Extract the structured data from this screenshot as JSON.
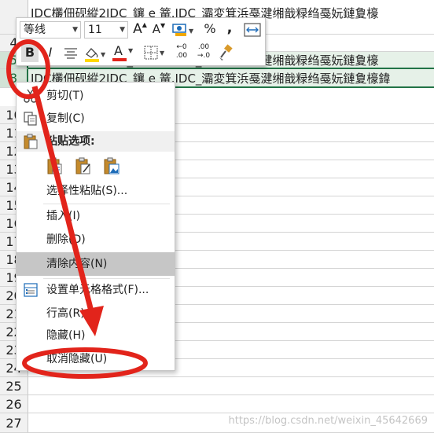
{
  "sheet": {
    "top_text": "IDC欉佃砚縱2IDC_鑲 e 篭.IDC_灞変箕浜戞湕缃戠粶绉戞妧鏈夐檺",
    "row5_text": "IDC欉佃砚縱2IDC_鑲 e 篭.IDC_灞変箕浜戞湕缃戠粶绉戞妧鏈夐檺",
    "row8_text": "IDC欉佃砚縱2IDC_鑲 e 篭.IDC_灞変箕浜戞湕缃戠粶绉戞妧鏈夐檺鍏",
    "row_numbers": [
      "4",
      "5",
      "8",
      "10",
      "11",
      "12",
      "13",
      "14",
      "15",
      "16",
      "17",
      "18",
      "19",
      "20",
      "21",
      "22",
      "23",
      "24",
      "25",
      "26",
      "27"
    ]
  },
  "mini_toolbar": {
    "font_name": "等线",
    "font_size": "11",
    "grow_font": "A",
    "shrink_font": "A",
    "percent": "%",
    "comma": ",",
    "bold": "B",
    "italic": "I",
    "font_color_letter": "A",
    "inc_decimal_top": "←0",
    "inc_decimal_bottom": ".00",
    "dec_decimal_top": ".00",
    "dec_decimal_bottom": "→.0",
    "accent_red": "#e2241b",
    "fill_yellow": "#ffd800"
  },
  "context_menu": {
    "cut": "剪切(T)",
    "copy": "复制(C)",
    "paste_options": "粘贴选项:",
    "paste_special": "选择性粘贴(S)...",
    "insert": "插入(I)",
    "delete": "删除(D)",
    "clear_contents": "清除内容(N)",
    "format_cells": "设置单元格格式(F)...",
    "row_height": "行高(R)...",
    "hide": "隐藏(H)",
    "unhide": "取消隐藏(U)"
  },
  "watermark": "https://blog.csdn.net/weixin_45642669",
  "annotation_color": "#e2241b"
}
